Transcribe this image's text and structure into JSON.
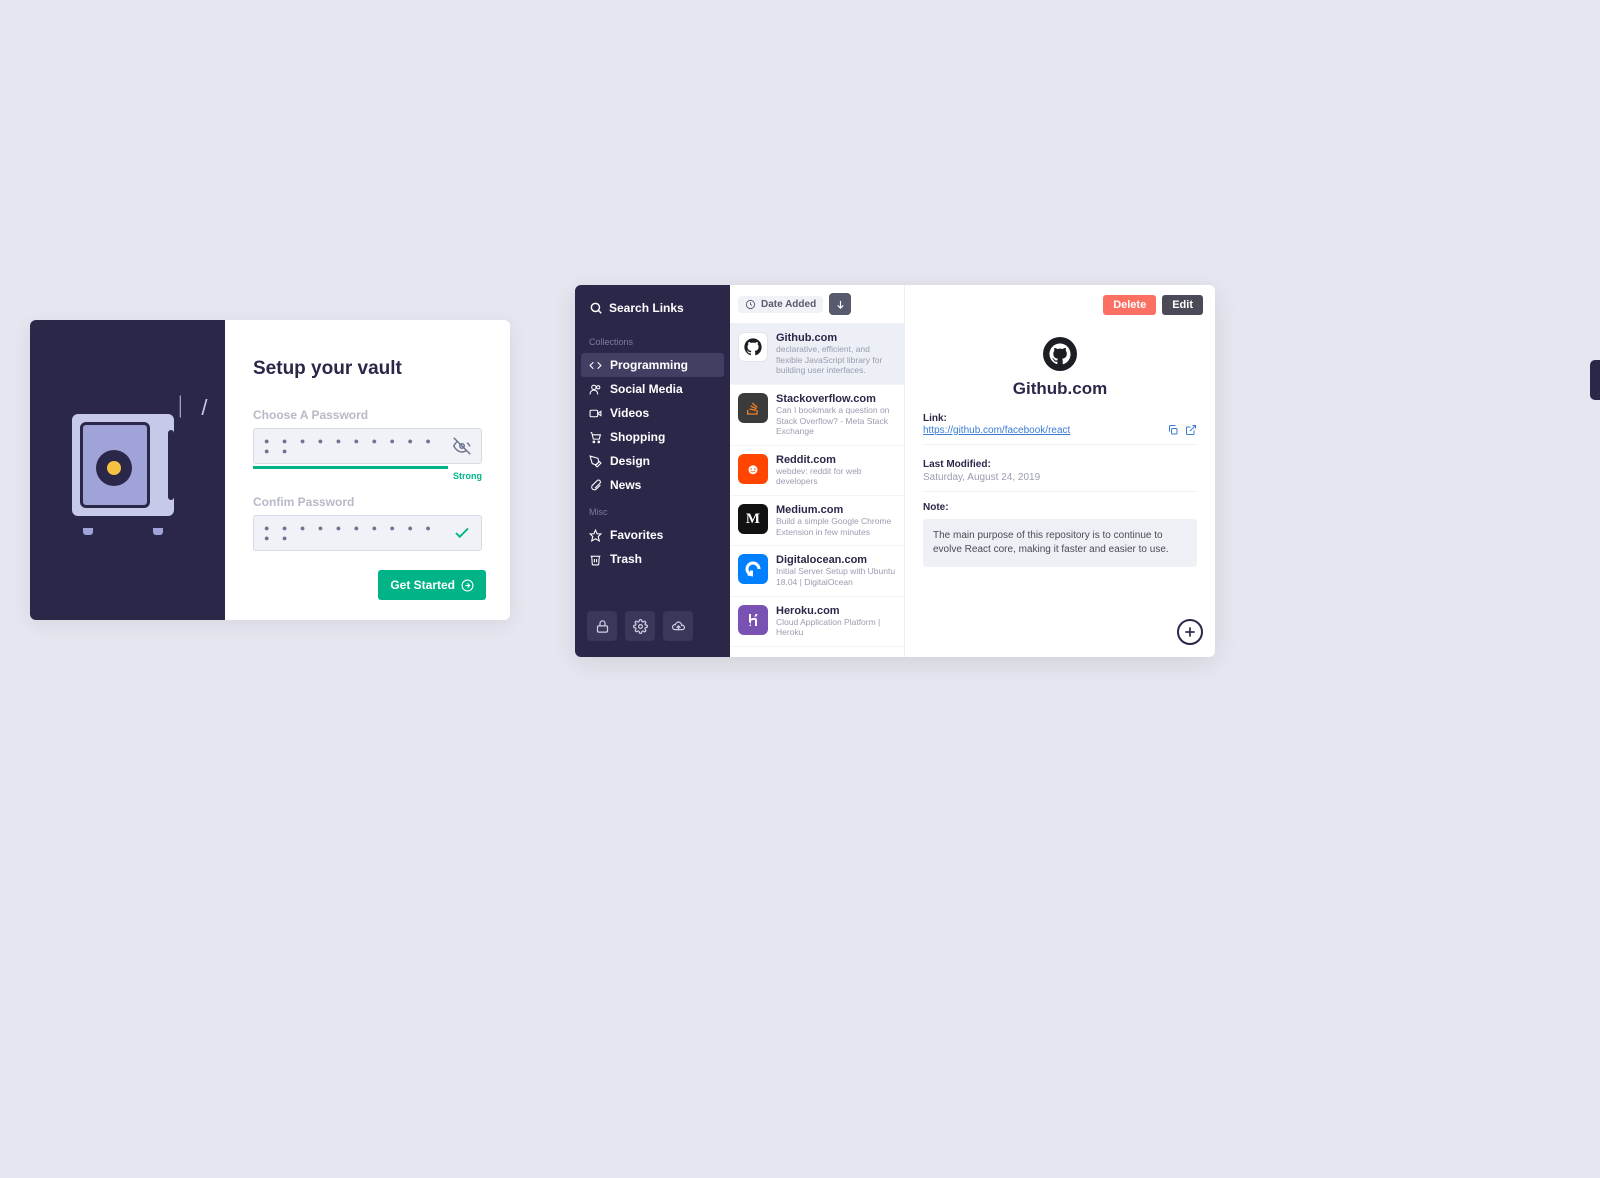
{
  "vault": {
    "title": "Setup your vault",
    "password_label": "Choose A Password",
    "password_dots": "● ● ● ● ● ● ● ● ● ● ● ●",
    "strength_text": "Strong",
    "confirm_label": "Confim Password",
    "confirm_dots": "● ● ● ● ● ● ● ● ● ● ● ●",
    "get_started_label": "Get Started"
  },
  "links": {
    "search_placeholder": "Search Links",
    "sections": {
      "collections_label": "Collections",
      "misc_label": "Misc"
    },
    "collections": [
      {
        "icon": "code",
        "label": "Programming"
      },
      {
        "icon": "users",
        "label": "Social Media"
      },
      {
        "icon": "video",
        "label": "Videos"
      },
      {
        "icon": "cart",
        "label": "Shopping"
      },
      {
        "icon": "pen",
        "label": "Design"
      },
      {
        "icon": "paperclip",
        "label": "News"
      }
    ],
    "misc": [
      {
        "icon": "star",
        "label": "Favorites"
      },
      {
        "icon": "trash",
        "label": "Trash"
      }
    ],
    "sort": {
      "label": "Date Added"
    },
    "entries": [
      {
        "title": "Github.com",
        "sub": "declarative, efficient, and flexible JavaScript library for building user interfaces.",
        "color": "#fff",
        "fg": "#1b1f23",
        "glyph": "gh"
      },
      {
        "title": "Stackoverflow.com",
        "sub": "Can I bookmark a question on Stack Overflow? - Meta Stack Exchange",
        "color": "#3b3b3b",
        "glyph": "so"
      },
      {
        "title": "Reddit.com",
        "sub": "webdev: reddit for web developers",
        "color": "#ff4500",
        "glyph": "rd"
      },
      {
        "title": "Medium.com",
        "sub": "Build a simple Google Chrome Extension in few minutes",
        "color": "#111",
        "glyph": "M"
      },
      {
        "title": "Digitalocean.com",
        "sub": "Initial Server Setup with Ubuntu 18.04 | DigitalOcean",
        "color": "#0080ff",
        "glyph": "do"
      },
      {
        "title": "Heroku.com",
        "sub": "Cloud Application Platform | Heroku",
        "color": "#7952b3",
        "glyph": "H"
      }
    ],
    "detail": {
      "delete_label": "Delete",
      "edit_label": "Edit",
      "title": "Github.com",
      "link_label": "Link:",
      "link_value": "https://github.com/facebook/react",
      "modified_label": "Last Modified:",
      "modified_value": "Saturday, August 24, 2019",
      "note_label": "Note:",
      "note_value": "The main purpose of this repository is to continue to evolve React core, making it faster and easier to use."
    }
  }
}
